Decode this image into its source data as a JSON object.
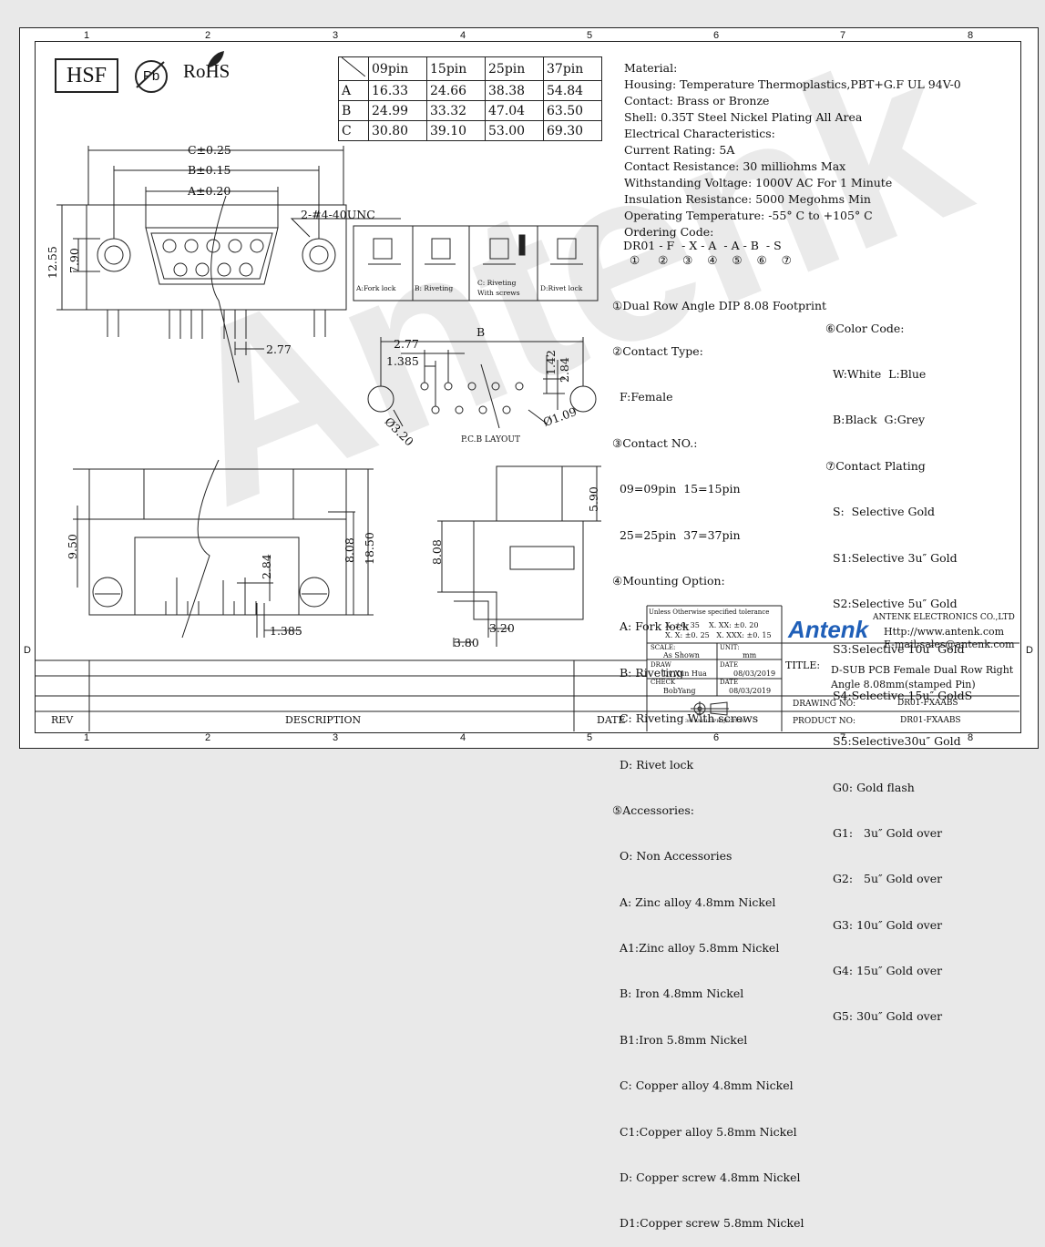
{
  "grid": {
    "columns": [
      "1",
      "2",
      "3",
      "4",
      "5",
      "6",
      "7",
      "8"
    ],
    "rows": [
      "D"
    ]
  },
  "logos": {
    "hsf": "HSF",
    "pb": "Pb",
    "rohs": "RoHS"
  },
  "dim_table": {
    "header": [
      "09pin",
      "15pin",
      "25pin",
      "37pin"
    ],
    "rows": [
      {
        "label": "A",
        "values": [
          "16.33",
          "24.66",
          "38.38",
          "54.84"
        ]
      },
      {
        "label": "B",
        "values": [
          "24.99",
          "33.32",
          "47.04",
          "63.50"
        ]
      },
      {
        "label": "C",
        "values": [
          "30.80",
          "39.10",
          "53.00",
          "69.30"
        ]
      }
    ]
  },
  "dims": {
    "c": "C±0.25",
    "b": "B±0.15",
    "a": "A±0.20",
    "unc": "2-#4-40UNC",
    "h1255": "12.55",
    "h790": "7.90",
    "p277": "2.77",
    "pcb_b": "B",
    "pcb_277": "2.77",
    "pcb_1385": "1.385",
    "pcb_142": "1.42",
    "pcb_284": "2.84",
    "pcb_d320": "Ø3.20",
    "pcb_d109": "Ø1.09",
    "pcb_layout": "P.C.B LAYOUT",
    "v950": "9.50",
    "v808": "8.08",
    "v1850": "18.50",
    "v284": "2.84",
    "v1385": "1.385",
    "s590": "5.90",
    "s808": "8.08",
    "s320": "3.20",
    "s380": "3.80"
  },
  "mount_options": [
    {
      "label": "A:Fork lock"
    },
    {
      "label": "B: Riveting"
    },
    {
      "label": "C: Riveting With screws"
    },
    {
      "label": "D:Rivet lock"
    }
  ],
  "spec": [
    "Material:",
    "Housing: Temperature Thermoplastics,PBT+G.F UL 94V-0",
    "Contact: Brass or Bronze",
    "Shell: 0.35T Steel Nickel Plating All Area",
    "Electrical Characteristics:",
    "Current Rating: 5A",
    "Contact Resistance: 30 milliohms Max",
    "Withstanding Voltage: 1000V AC For 1 Minute",
    "Insulation Resistance: 5000  Megohms Min",
    "Operating Temperature: -55° C  to  +105° C",
    "Ordering Code:"
  ],
  "ordering_code": {
    "text": "DR01 - F  - X - A  - A - B  - S",
    "nums": "①     ②    ③    ④    ⑤    ⑥    ⑦"
  },
  "options_left": [
    "①Dual Row Angle DIP 8.08 Footprint",
    "②Contact Type:",
    "  F:Female",
    "③Contact NO.:",
    "  09=09pin  15=15pin",
    "  25=25pin  37=37pin",
    "④Mounting Option:",
    "  A: Fork lock",
    "  B: Riveting",
    "  C: Riveting With screws",
    "  D: Rivet lock",
    "⑤Accessories:",
    "  O: Non Accessories",
    "  A: Zinc alloy 4.8mm Nickel",
    "  A1:Zinc alloy 5.8mm Nickel",
    "  B: Iron 4.8mm Nickel",
    "  B1:Iron 5.8mm Nickel",
    "  C: Copper alloy 4.8mm Nickel",
    "  C1:Copper alloy 5.8mm Nickel",
    "  D: Copper screw 4.8mm Nickel",
    "  D1:Copper screw 5.8mm Nickel"
  ],
  "options_right": [
    "⑥Color Code:",
    "  W:White  L:Blue",
    "  B:Black  G:Grey",
    "⑦Contact Plating",
    "  S:  Selective Gold",
    "  S1:Selective 3u″ Gold",
    "  S2:Selective 5u″ Gold",
    "  S3:Selective 10u″ Gold",
    "  S4:Selective 15u″ GoldS",
    "  S5:Selective30u″ Gold",
    "  G0: Gold flash",
    "  G1:   3u″ Gold over",
    "  G2:   5u″ Gold over",
    "  G3: 10u″ Gold over",
    "  G4: 15u″ Gold over",
    "  G5: 30u″ Gold over"
  ],
  "title_block": {
    "tolerance_title": "Unless Otherwise specified tolerance",
    "tol1": "X. ±0. 35    X. XX: ±0. 20",
    "tol2": "X. X: ±0. 25   X. XXX: ±0. 15",
    "scale_label": "SCALE:",
    "scale_value": "As Shown",
    "unit_label": "UNIT:",
    "unit_value": "mm",
    "draw_label": "DRAW",
    "draw_value": "Lv Xun Hua",
    "date_label": "DATE",
    "draw_date": "08/03/2019",
    "check_label": "CHECK",
    "check_value": "BobYang",
    "check_date": "08/03/2019",
    "projection": "3rd ANGLE PROJECTION",
    "company": "ANTENK ELECTRONICS CO.,LTD",
    "http": "Http://www.antenk.com",
    "email": "E-mail:sales@antenk.com",
    "brand": "Antenk",
    "title_label": "TITLE:",
    "title_line1": "D-SUB PCB Female Dual Row Right",
    "title_line2": "Angle 8.08mm(stamped Pin)",
    "drawing_label": "DRAWING NO:",
    "drawing_no": "DR01-FXAABS",
    "product_label": "PRODUCT NO:",
    "product_no": "DR01-FXAABS",
    "rev": "REV",
    "description": "DESCRIPTION",
    "date": "DATE"
  },
  "watermark": "Antenk"
}
